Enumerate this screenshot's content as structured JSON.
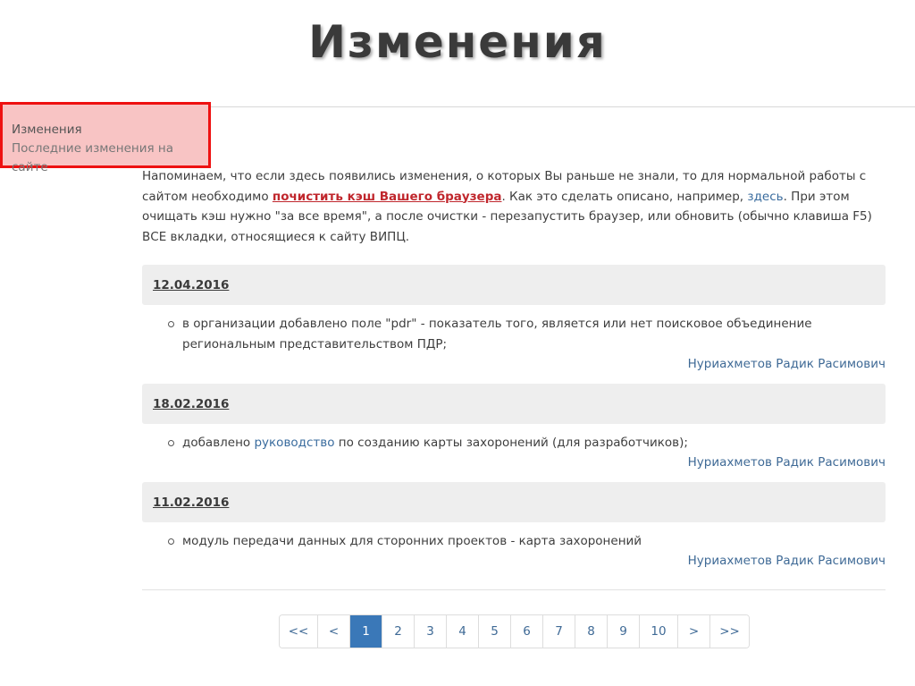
{
  "slide": {
    "title": "Изменения"
  },
  "callout": {
    "title": "Изменения",
    "subtitle": "Последние изменения на сайте"
  },
  "notice": {
    "part1": "Напоминаем, что если здесь появились изменения, о которых Вы раньше не знали, то для нормальной работы с сайтом необходимо ",
    "link1": "почистить кэш Вашего браузера",
    "part2": ". Как это сделать описано, например, ",
    "link2": "здесь",
    "part3": ". При этом очищать кэш нужно \"за все время\", а после очистки - перезапустить браузер, или обновить (обычно клавиша F5) ВСЕ вкладки, относящиеся к сайту ВИПЦ."
  },
  "entries": [
    {
      "date": "12.04.2016",
      "text": "в организации добавлено поле \"pdr\" - показатель того, является или нет поисковое объединение региональным представительством ПДР;",
      "author": "Нуриахметов Радик Расимович"
    },
    {
      "date": "18.02.2016",
      "text_before": "добавлено ",
      "link": "руководство",
      "text_after": " по созданию карты захоронений (для разработчиков);",
      "author": "Нуриахметов Радик Расимович"
    },
    {
      "date": "11.02.2016",
      "text": "модуль передачи данных для сторонних проектов - карта захоронений",
      "author": "Нуриахметов Радик Расимович"
    }
  ],
  "pagination": {
    "first": "<<",
    "prev": "<",
    "pages": [
      "1",
      "2",
      "3",
      "4",
      "5",
      "6",
      "7",
      "8",
      "9",
      "10"
    ],
    "next": ">",
    "last": ">>",
    "active": "1"
  },
  "colors": {
    "accent": "#3a78b8",
    "link": "#3a6c9e",
    "highlight_red": "#c0272d",
    "callout_border": "#ee1111",
    "callout_bg": "#f8c4c4"
  }
}
